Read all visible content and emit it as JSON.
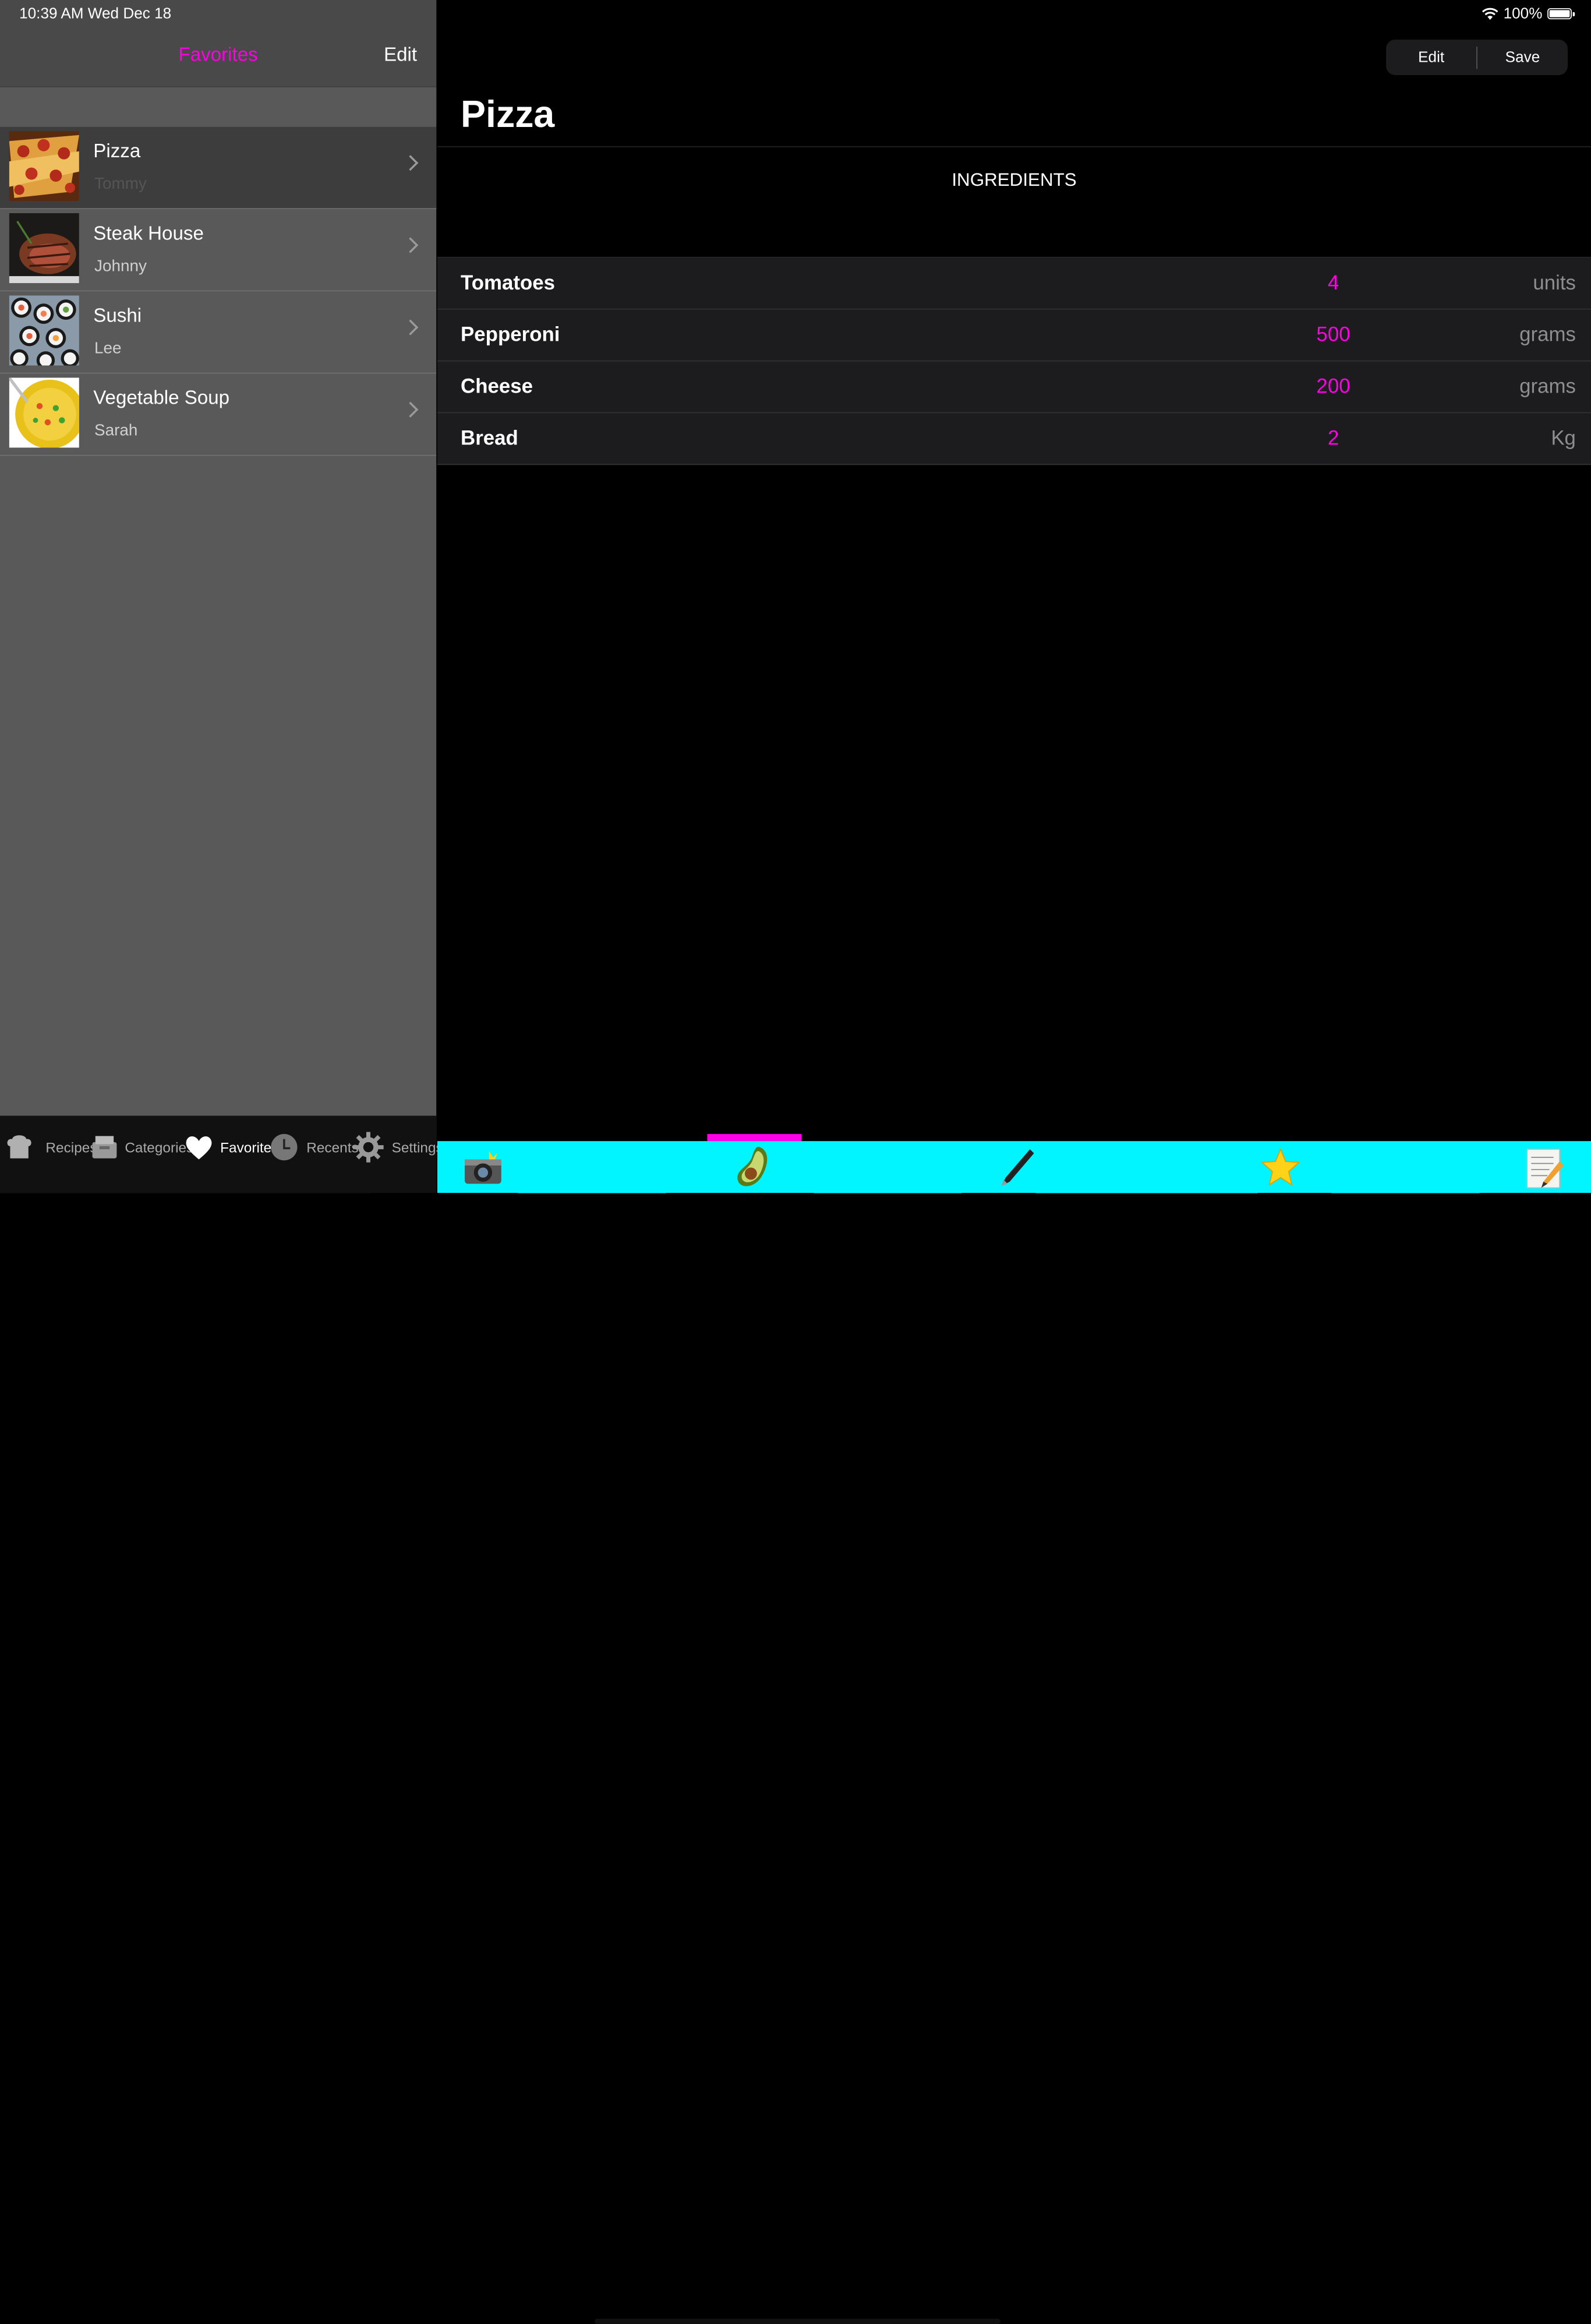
{
  "status": {
    "time": "10:39 AM   Wed Dec 18",
    "battery": "100%"
  },
  "sidebar": {
    "title": "Favorites",
    "edit_label": "Edit",
    "items": [
      {
        "title": "Pizza",
        "subtitle": "Tommy",
        "selected": true,
        "thumb": "pizza"
      },
      {
        "title": "Steak House",
        "subtitle": "Johnny",
        "thumb": "steak"
      },
      {
        "title": "Sushi",
        "subtitle": "Lee",
        "thumb": "sushi"
      },
      {
        "title": "Vegetable Soup",
        "subtitle": "Sarah",
        "thumb": "soup"
      }
    ],
    "tabs": [
      {
        "label": "Recipes",
        "icon": "chef-hat-icon"
      },
      {
        "label": "Categories",
        "icon": "tray-icon"
      },
      {
        "label": "Favorites",
        "icon": "heart-icon",
        "active": true
      },
      {
        "label": "Recents",
        "icon": "clock-icon"
      },
      {
        "label": "Settings",
        "icon": "gear-icon"
      }
    ]
  },
  "detail": {
    "edit_label": "Edit",
    "save_label": "Save",
    "title": "Pizza",
    "section": "INGREDIENTS",
    "ingredients": [
      {
        "name": "Tomatoes",
        "qty": "4",
        "unit": "units"
      },
      {
        "name": "Pepperoni",
        "qty": "500",
        "unit": "grams"
      },
      {
        "name": "Cheese",
        "qty": "200",
        "unit": "grams"
      },
      {
        "name": "Bread",
        "qty": "2",
        "unit": "Kg"
      }
    ],
    "toolbar_icons": [
      "camera-icon",
      "avocado-icon",
      "pen-icon",
      "star-icon",
      "notepad-icon"
    ]
  },
  "colors": {
    "accent": "#ff00e6",
    "toolbar": "#00f5ff"
  }
}
